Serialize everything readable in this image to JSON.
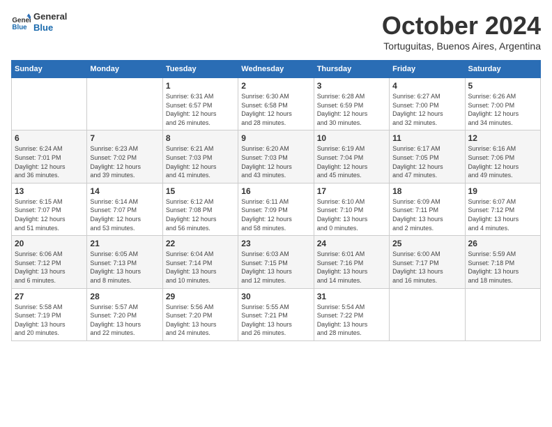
{
  "header": {
    "logo_line1": "General",
    "logo_line2": "Blue",
    "month": "October 2024",
    "location": "Tortuguitas, Buenos Aires, Argentina"
  },
  "weekdays": [
    "Sunday",
    "Monday",
    "Tuesday",
    "Wednesday",
    "Thursday",
    "Friday",
    "Saturday"
  ],
  "weeks": [
    [
      {
        "day": "",
        "info": ""
      },
      {
        "day": "",
        "info": ""
      },
      {
        "day": "1",
        "info": "Sunrise: 6:31 AM\nSunset: 6:57 PM\nDaylight: 12 hours\nand 26 minutes."
      },
      {
        "day": "2",
        "info": "Sunrise: 6:30 AM\nSunset: 6:58 PM\nDaylight: 12 hours\nand 28 minutes."
      },
      {
        "day": "3",
        "info": "Sunrise: 6:28 AM\nSunset: 6:59 PM\nDaylight: 12 hours\nand 30 minutes."
      },
      {
        "day": "4",
        "info": "Sunrise: 6:27 AM\nSunset: 7:00 PM\nDaylight: 12 hours\nand 32 minutes."
      },
      {
        "day": "5",
        "info": "Sunrise: 6:26 AM\nSunset: 7:00 PM\nDaylight: 12 hours\nand 34 minutes."
      }
    ],
    [
      {
        "day": "6",
        "info": "Sunrise: 6:24 AM\nSunset: 7:01 PM\nDaylight: 12 hours\nand 36 minutes."
      },
      {
        "day": "7",
        "info": "Sunrise: 6:23 AM\nSunset: 7:02 PM\nDaylight: 12 hours\nand 39 minutes."
      },
      {
        "day": "8",
        "info": "Sunrise: 6:21 AM\nSunset: 7:03 PM\nDaylight: 12 hours\nand 41 minutes."
      },
      {
        "day": "9",
        "info": "Sunrise: 6:20 AM\nSunset: 7:03 PM\nDaylight: 12 hours\nand 43 minutes."
      },
      {
        "day": "10",
        "info": "Sunrise: 6:19 AM\nSunset: 7:04 PM\nDaylight: 12 hours\nand 45 minutes."
      },
      {
        "day": "11",
        "info": "Sunrise: 6:17 AM\nSunset: 7:05 PM\nDaylight: 12 hours\nand 47 minutes."
      },
      {
        "day": "12",
        "info": "Sunrise: 6:16 AM\nSunset: 7:06 PM\nDaylight: 12 hours\nand 49 minutes."
      }
    ],
    [
      {
        "day": "13",
        "info": "Sunrise: 6:15 AM\nSunset: 7:07 PM\nDaylight: 12 hours\nand 51 minutes."
      },
      {
        "day": "14",
        "info": "Sunrise: 6:14 AM\nSunset: 7:07 PM\nDaylight: 12 hours\nand 53 minutes."
      },
      {
        "day": "15",
        "info": "Sunrise: 6:12 AM\nSunset: 7:08 PM\nDaylight: 12 hours\nand 56 minutes."
      },
      {
        "day": "16",
        "info": "Sunrise: 6:11 AM\nSunset: 7:09 PM\nDaylight: 12 hours\nand 58 minutes."
      },
      {
        "day": "17",
        "info": "Sunrise: 6:10 AM\nSunset: 7:10 PM\nDaylight: 13 hours\nand 0 minutes."
      },
      {
        "day": "18",
        "info": "Sunrise: 6:09 AM\nSunset: 7:11 PM\nDaylight: 13 hours\nand 2 minutes."
      },
      {
        "day": "19",
        "info": "Sunrise: 6:07 AM\nSunset: 7:12 PM\nDaylight: 13 hours\nand 4 minutes."
      }
    ],
    [
      {
        "day": "20",
        "info": "Sunrise: 6:06 AM\nSunset: 7:12 PM\nDaylight: 13 hours\nand 6 minutes."
      },
      {
        "day": "21",
        "info": "Sunrise: 6:05 AM\nSunset: 7:13 PM\nDaylight: 13 hours\nand 8 minutes."
      },
      {
        "day": "22",
        "info": "Sunrise: 6:04 AM\nSunset: 7:14 PM\nDaylight: 13 hours\nand 10 minutes."
      },
      {
        "day": "23",
        "info": "Sunrise: 6:03 AM\nSunset: 7:15 PM\nDaylight: 13 hours\nand 12 minutes."
      },
      {
        "day": "24",
        "info": "Sunrise: 6:01 AM\nSunset: 7:16 PM\nDaylight: 13 hours\nand 14 minutes."
      },
      {
        "day": "25",
        "info": "Sunrise: 6:00 AM\nSunset: 7:17 PM\nDaylight: 13 hours\nand 16 minutes."
      },
      {
        "day": "26",
        "info": "Sunrise: 5:59 AM\nSunset: 7:18 PM\nDaylight: 13 hours\nand 18 minutes."
      }
    ],
    [
      {
        "day": "27",
        "info": "Sunrise: 5:58 AM\nSunset: 7:19 PM\nDaylight: 13 hours\nand 20 minutes."
      },
      {
        "day": "28",
        "info": "Sunrise: 5:57 AM\nSunset: 7:20 PM\nDaylight: 13 hours\nand 22 minutes."
      },
      {
        "day": "29",
        "info": "Sunrise: 5:56 AM\nSunset: 7:20 PM\nDaylight: 13 hours\nand 24 minutes."
      },
      {
        "day": "30",
        "info": "Sunrise: 5:55 AM\nSunset: 7:21 PM\nDaylight: 13 hours\nand 26 minutes."
      },
      {
        "day": "31",
        "info": "Sunrise: 5:54 AM\nSunset: 7:22 PM\nDaylight: 13 hours\nand 28 minutes."
      },
      {
        "day": "",
        "info": ""
      },
      {
        "day": "",
        "info": ""
      }
    ]
  ]
}
